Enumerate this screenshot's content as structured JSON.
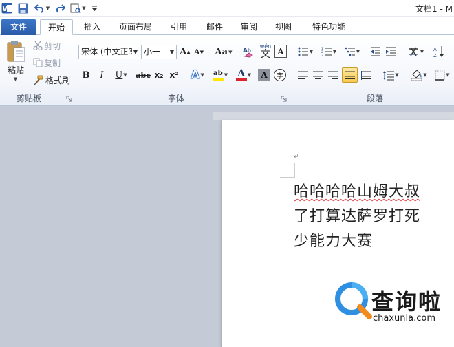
{
  "window": {
    "title": "文档1 - M"
  },
  "tabs": [
    {
      "label": "文件"
    },
    {
      "label": "开始"
    },
    {
      "label": "插入"
    },
    {
      "label": "页面布局"
    },
    {
      "label": "引用"
    },
    {
      "label": "邮件"
    },
    {
      "label": "审阅"
    },
    {
      "label": "视图"
    },
    {
      "label": "特色功能"
    }
  ],
  "clipboard": {
    "group_label": "剪贴板",
    "paste_label": "粘贴",
    "cut_label": "剪切",
    "copy_label": "复制",
    "format_painter_label": "格式刷"
  },
  "font": {
    "group_label": "字体",
    "font_name": "宋体 (中文正3",
    "font_size": "小一",
    "grow_label": "A",
    "shrink_label": "A",
    "case_label": "Aa",
    "phonetic_label": "wén",
    "phonetic_char": "文",
    "border_label": "A",
    "bold": "B",
    "italic": "I",
    "underline": "U",
    "strike": "abc",
    "subscript": "x₂",
    "superscript": "x²",
    "effects_label": "A",
    "highlight_label": "ab",
    "font_color_label": "A",
    "shading_label": "A",
    "encircle_label": "字"
  },
  "paragraph": {
    "group_label": "段落"
  },
  "colors": {
    "highlight": "#ffe600",
    "font_color": "#d9262d",
    "accent": "#2b5fae"
  },
  "document": {
    "lines": [
      {
        "text": "哈哈哈哈山姆大叔"
      },
      {
        "text": "了打算达萨罗打死"
      },
      {
        "text": "少能力大赛"
      }
    ]
  },
  "watermark": {
    "logo_text": "查询啦",
    "url": "chaxunla.com"
  }
}
